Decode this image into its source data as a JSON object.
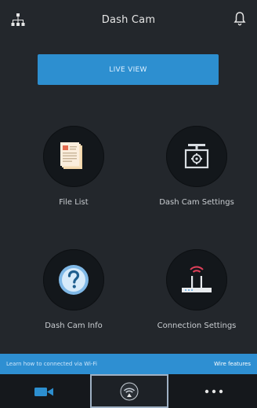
{
  "app": {
    "title": "Dash Cam"
  },
  "header": {
    "left_icon": "network-icon",
    "right_icon": "bell-icon"
  },
  "primary_button": {
    "label": "LIVE VIEW"
  },
  "tiles": [
    {
      "label": "File List",
      "icon": "file-list-icon"
    },
    {
      "label": "Dash Cam Settings",
      "icon": "dashcam-settings-icon"
    },
    {
      "label": "Dash Cam Info",
      "icon": "question-icon"
    },
    {
      "label": "Connection Settings",
      "icon": "router-icon"
    }
  ],
  "banner": {
    "message": "Learn how to connected via Wi-Fi",
    "link": "Wire features"
  },
  "tabbar": {
    "items": [
      {
        "name": "video-tab",
        "icon": "video-camera-icon"
      },
      {
        "name": "wifi-tab",
        "icon": "wifi-icon"
      },
      {
        "name": "more-tab",
        "icon": "more-icon"
      }
    ]
  },
  "colors": {
    "accent": "#2d8fd0",
    "background": "#23272c",
    "tab_bar": "#15181c"
  }
}
